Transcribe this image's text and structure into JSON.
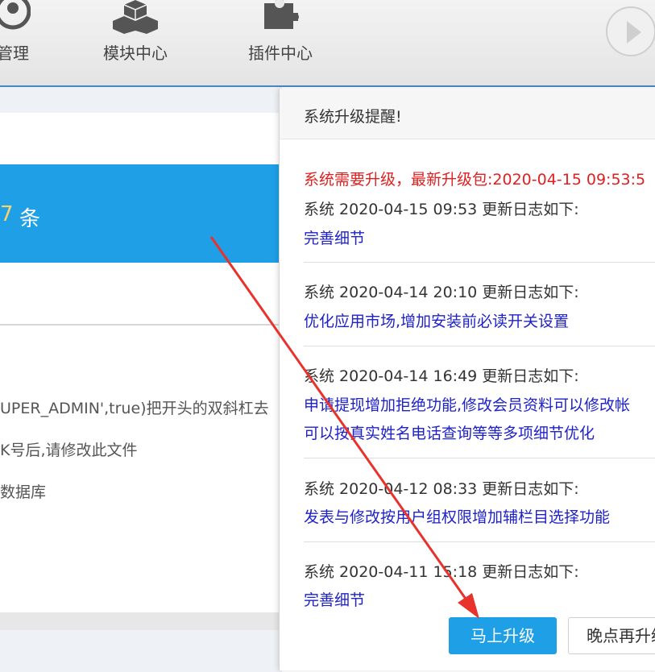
{
  "nav": {
    "items": [
      {
        "label": "管理",
        "icon": "user-circle-icon"
      },
      {
        "label": "模块中心",
        "icon": "cubes-icon"
      },
      {
        "label": "插件中心",
        "icon": "puzzle-icon"
      }
    ],
    "next_icon": "next-arrow-icon"
  },
  "panel": {
    "count_tail": "7",
    "count_unit": "条",
    "lines": [
      "UPER_ADMIN',true)把开头的双斜杠去",
      "K号后,请修改此文件",
      "数据库"
    ]
  },
  "dialog": {
    "title": "系统升级提醒!",
    "alert": "系统需要升级，最新升级包:2020-04-15 09:53:5",
    "entries": [
      {
        "head": "系统 2020-04-15 09:53 更新日志如下:",
        "lines": [
          "完善细节"
        ]
      },
      {
        "head": "系统 2020-04-14 20:10 更新日志如下:",
        "lines": [
          "优化应用市场,增加安装前必读开关设置"
        ]
      },
      {
        "head": "系统 2020-04-14 16:49 更新日志如下:",
        "lines": [
          "申请提现增加拒绝功能,修改会员资料可以修改帐",
          "可以按真实姓名电话查询等等多项细节优化"
        ]
      },
      {
        "head": "系统 2020-04-12 08:33 更新日志如下:",
        "lines": [
          "发表与修改按用户组权限增加辅栏目选择功能"
        ]
      },
      {
        "head": "系统 2020-04-11 15:18 更新日志如下:",
        "lines": [
          "完善细节"
        ]
      }
    ],
    "upgrade_now": "马上升级",
    "upgrade_later": "晚点再升级"
  },
  "colors": {
    "accent": "#1e9fe6",
    "alert": "#e02020",
    "link": "#1f22c8",
    "highlight": "#f7d36b",
    "annotation_arrow": "#e8322c"
  }
}
